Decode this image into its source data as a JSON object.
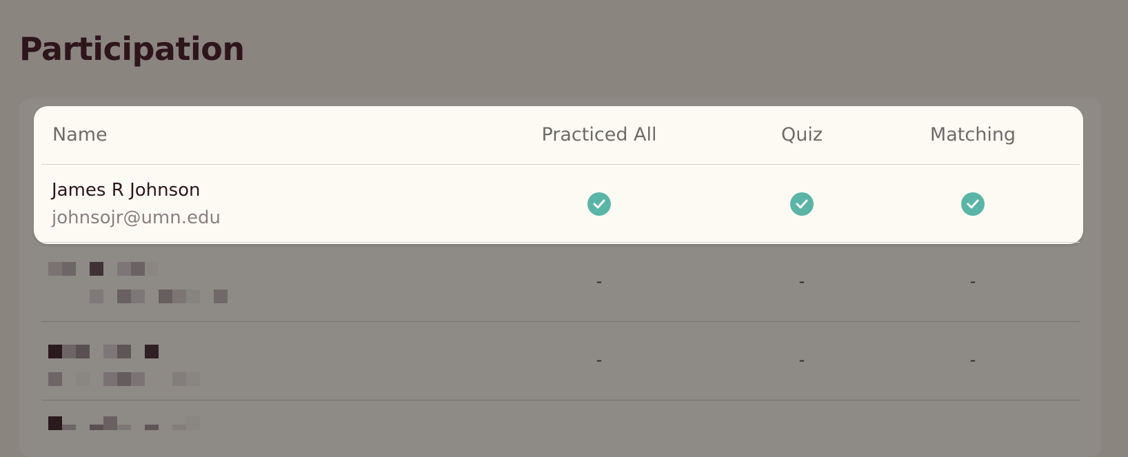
{
  "page": {
    "title": "Participation"
  },
  "table": {
    "headers": {
      "name": "Name",
      "practiced_all": "Practiced All",
      "quiz": "Quiz",
      "matching": "Matching"
    },
    "rows": [
      {
        "name": "James R Johnson",
        "email": "johnsojr@umn.edu",
        "practiced_all": "check-icon",
        "quiz": "check-icon",
        "matching": "check-icon"
      },
      {
        "name": "",
        "email": "",
        "redacted": true,
        "practiced_all": "-",
        "quiz": "-",
        "matching": "-"
      },
      {
        "name": "",
        "email": "",
        "redacted": true,
        "practiced_all": "-",
        "quiz": "-",
        "matching": "-"
      },
      {
        "name": "",
        "email": "",
        "redacted": true
      }
    ]
  },
  "colors": {
    "overlay": "#8b8580",
    "highlight_bg": "#fdfaf3",
    "title": "#2e151c",
    "check": "#5bb5a6"
  }
}
